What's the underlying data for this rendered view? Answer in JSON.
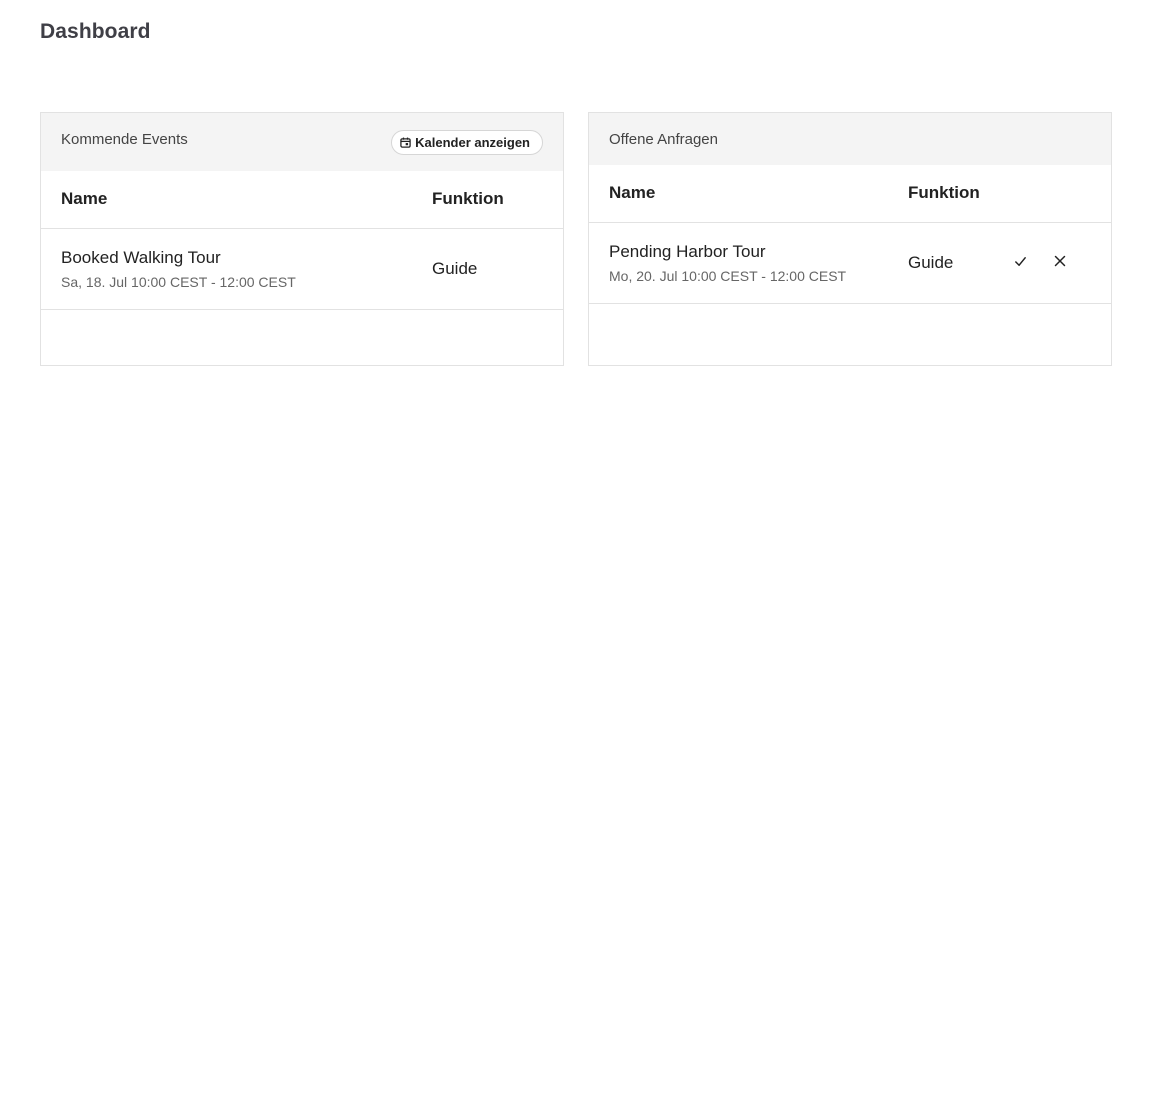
{
  "page": {
    "title": "Dashboard"
  },
  "upcoming": {
    "title": "Kommende Events",
    "calendar_button_label": "Kalender anzeigen",
    "columns": {
      "name": "Name",
      "function": "Funktion"
    },
    "rows": [
      {
        "title": "Booked Walking Tour",
        "date": "Sa, 18. Jul 10:00 CEST - 12:00 CEST",
        "function": "Guide"
      }
    ]
  },
  "requests": {
    "title": "Offene Anfragen",
    "columns": {
      "name": "Name",
      "function": "Funktion"
    },
    "rows": [
      {
        "title": "Pending Harbor Tour",
        "date": "Mo, 20. Jul 10:00 CEST - 12:00 CEST",
        "function": "Guide"
      }
    ]
  },
  "icons": {
    "calendar": "calendar-icon",
    "accept": "check-icon",
    "decline": "close-icon"
  }
}
